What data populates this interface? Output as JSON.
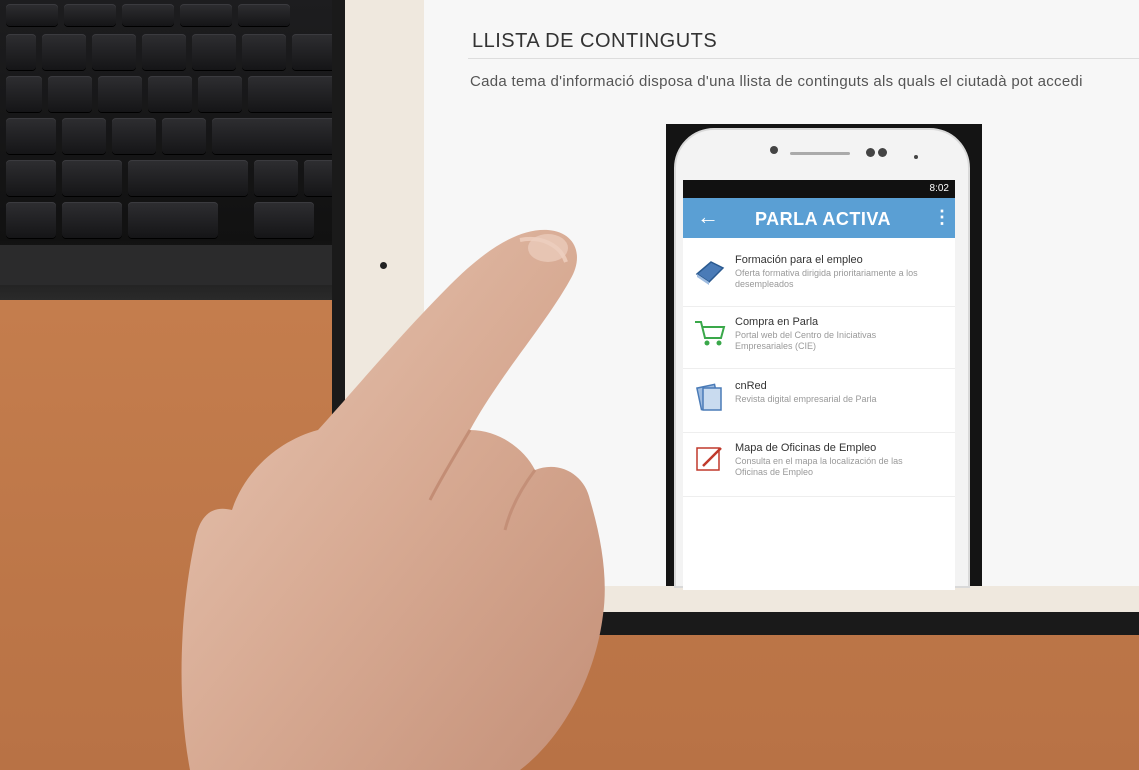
{
  "page": {
    "heading": "LLISTA DE CONTINGUTS",
    "description": "Cada tema d'informació disposa d'una llista de continguts als quals el ciutadà pot accedi"
  },
  "phone": {
    "status_time": "8:02",
    "app_title": "PARLA ACTIVA",
    "back_symbol": "←",
    "menu_symbol": "⋮",
    "items": [
      {
        "title": "Formación para el empleo",
        "subtitle": "Oferta formativa dirigida prioritariamente a los desempleados",
        "icon": "book-icon",
        "color": "#4a7bb7"
      },
      {
        "title": "Compra en Parla",
        "subtitle": "Portal web del Centro de Iniciativas Empresariales (CIE)",
        "icon": "cart-icon",
        "color": "#3aa84a"
      },
      {
        "title": "cnRed",
        "subtitle": "Revista digital empresarial de Parla",
        "icon": "magazine-icon",
        "color": "#4a7bb7"
      },
      {
        "title": "Mapa de Oficinas de Empleo",
        "subtitle": "Consulta en el mapa la localización de las Oficinas de Empleo",
        "icon": "pencil-icon",
        "color": "#c0392b"
      }
    ]
  },
  "colors": {
    "appbar": "#5a9fd4",
    "desk": "#c47d4d",
    "tablet_bezel": "#efe8de"
  }
}
